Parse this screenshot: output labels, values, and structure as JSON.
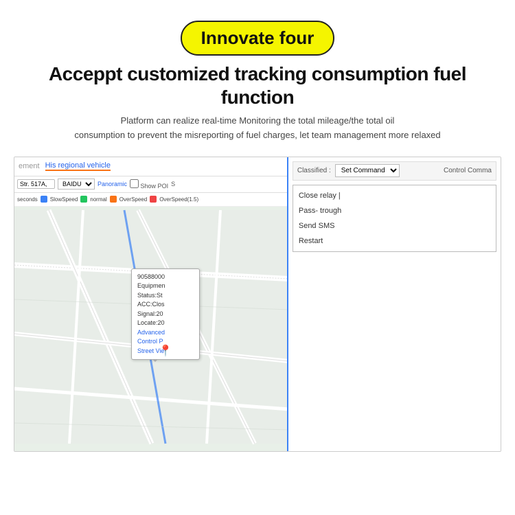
{
  "badge": {
    "text": "Innovate four"
  },
  "main_title": "Acceppt customized tracking consumption fuel function",
  "sub_title_line1": "Platform can realize real-time Monitoring  the total mileage/the total oil",
  "sub_title_line2": "consumption to prevent the misreporting of fuel charges, let team management more relaxed",
  "ui": {
    "left_panel": {
      "tab1": "ement",
      "tab2": "His regional vehicle",
      "toolbar": {
        "address": "Str. 517A,",
        "map_select": "BAIDU",
        "panoramic": "Panoramic",
        "show_poi": "Show POI",
        "s": "S"
      },
      "legend": {
        "seconds": "seconds",
        "slow_speed": "SlowSpeed",
        "normal": "normal",
        "over_speed": "OverSpeed",
        "over_speed_15": "OverSpeed(1.5)"
      },
      "popup": {
        "id": "90588000",
        "equipment": "Equipmen",
        "status": "Status:St",
        "acc": "ACC:Clos",
        "signal": "Signal:20",
        "locate": "Locate:20",
        "link1": "Advanced",
        "link2": "Control P",
        "link3": "Street Vie"
      }
    },
    "right_panel": {
      "classified_label": "Classified :",
      "set_command": "Set Command",
      "control_command_label": "Control Comma",
      "commands": [
        "Close relay |",
        "Pass- trough",
        "Send SMS",
        "Restart"
      ]
    }
  }
}
